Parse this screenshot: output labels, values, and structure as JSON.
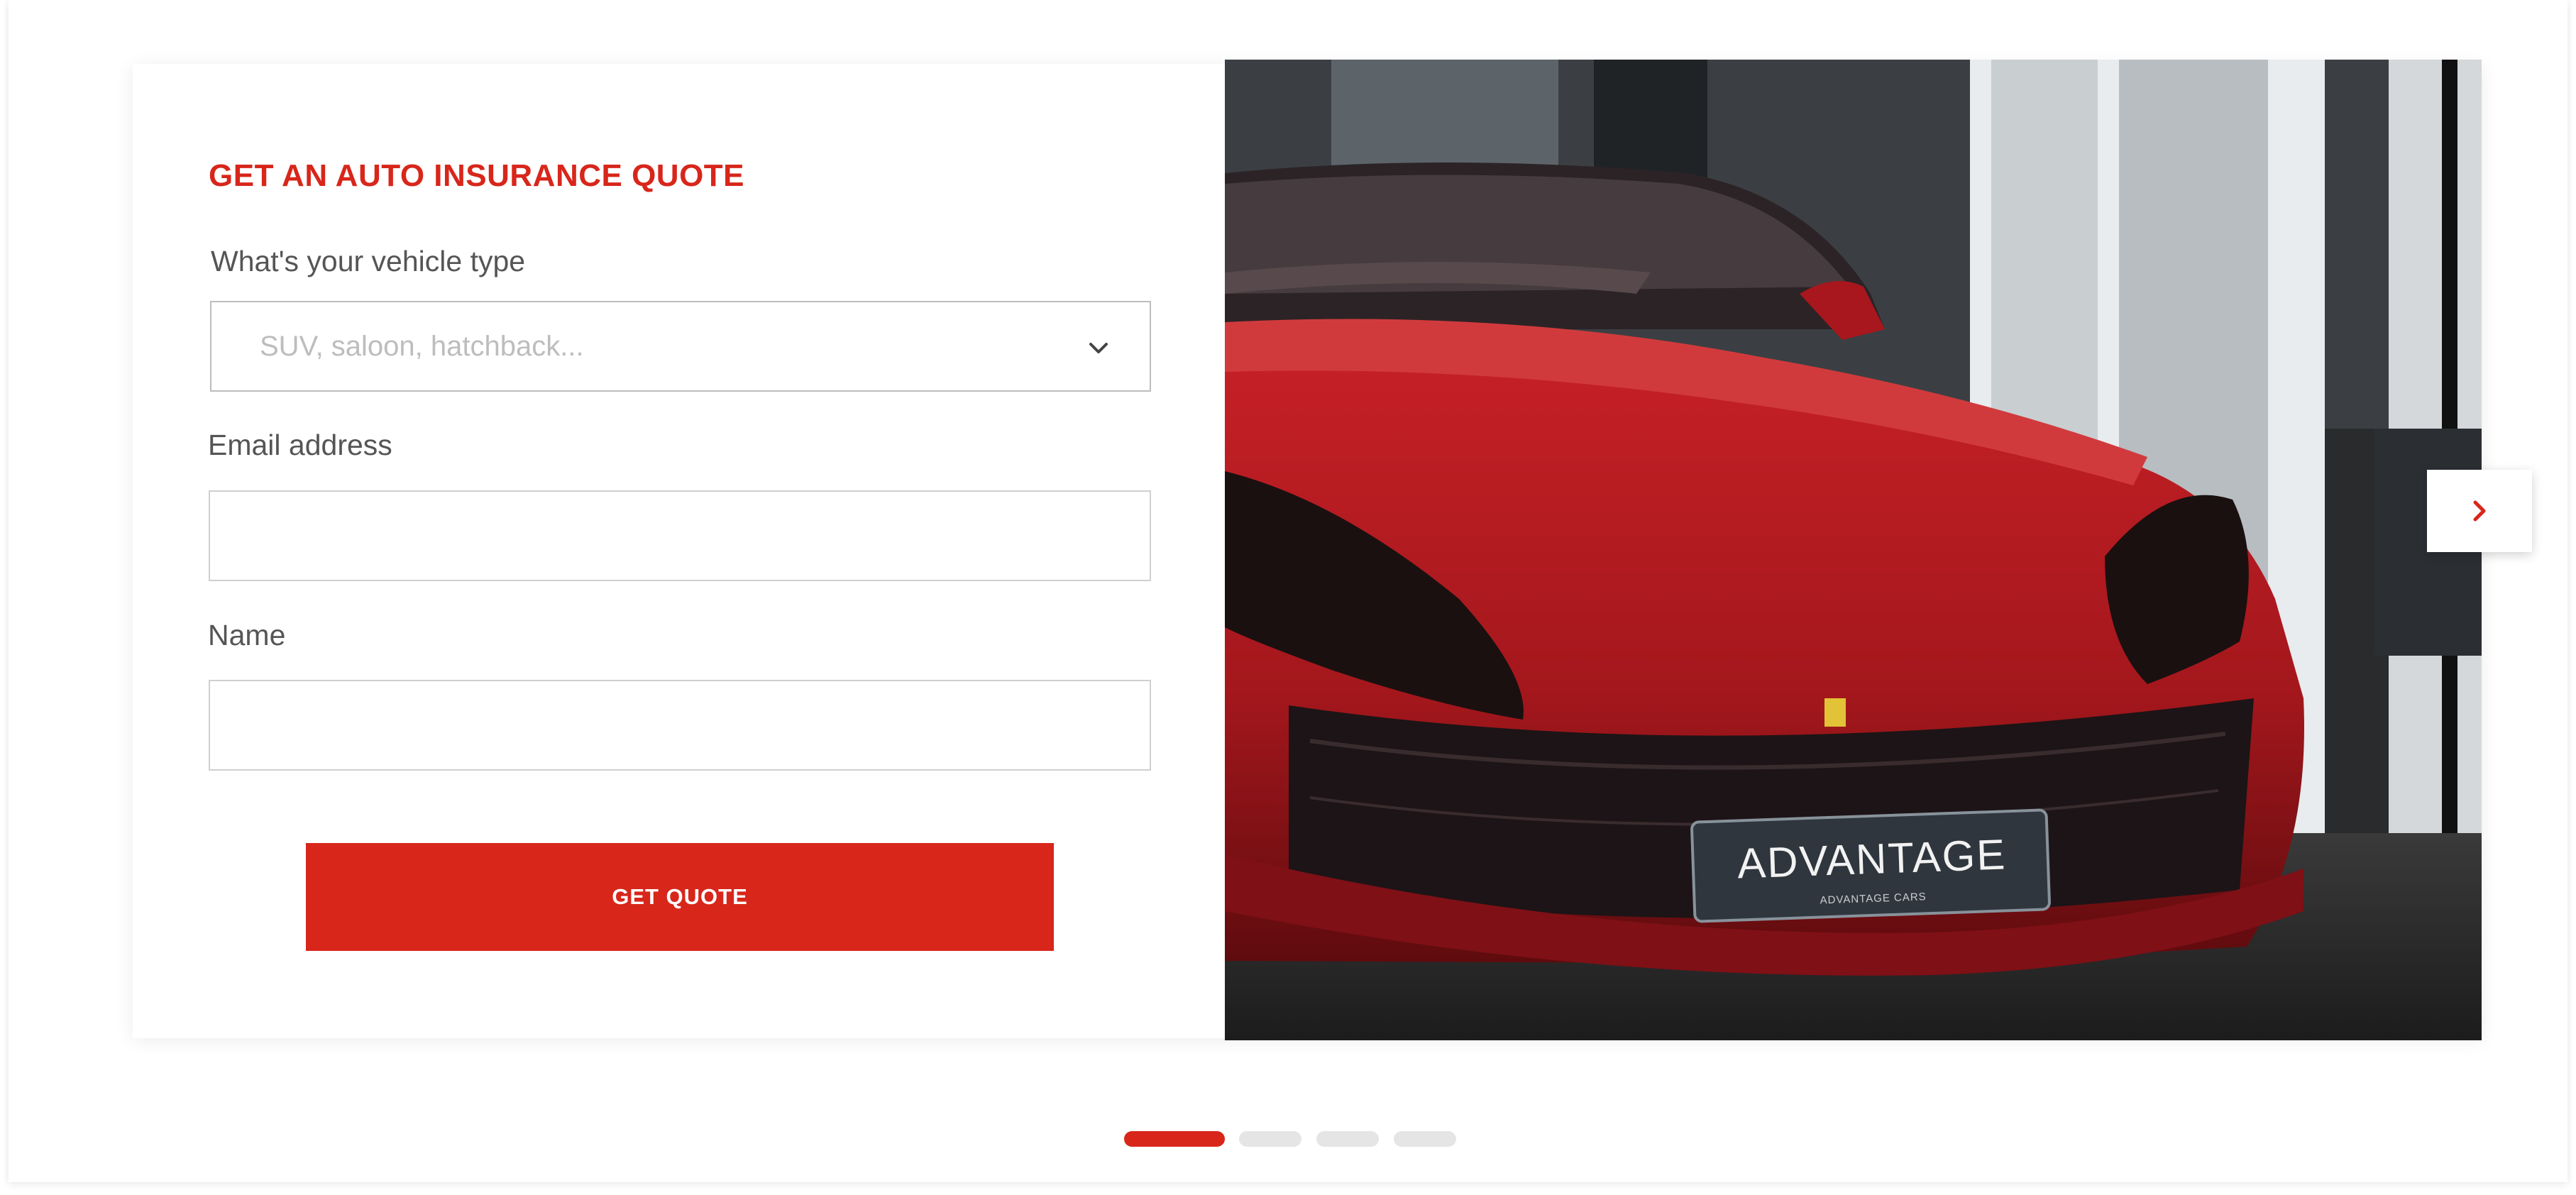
{
  "form": {
    "title": "GET AN AUTO INSURANCE QUOTE",
    "vehicle_label": "What's your vehicle type",
    "vehicle_placeholder": "SUV, saloon, hatchback...",
    "email_label": "Email address",
    "email_value": "",
    "name_label": "Name",
    "name_value": "",
    "submit_label": "GET QUOTE"
  },
  "hero": {
    "plate_text": "ADVANTAGE",
    "plate_subtext": "ADVANTAGE CARS"
  },
  "carousel": {
    "slide_count": 4,
    "active_index": 0
  },
  "colors": {
    "accent": "#d8261b",
    "dot_inactive": "#e5e5e5",
    "car_red": "#b01a1f"
  },
  "icons": {
    "dropdown": "chevron-down-icon",
    "next": "chevron-right-icon"
  }
}
